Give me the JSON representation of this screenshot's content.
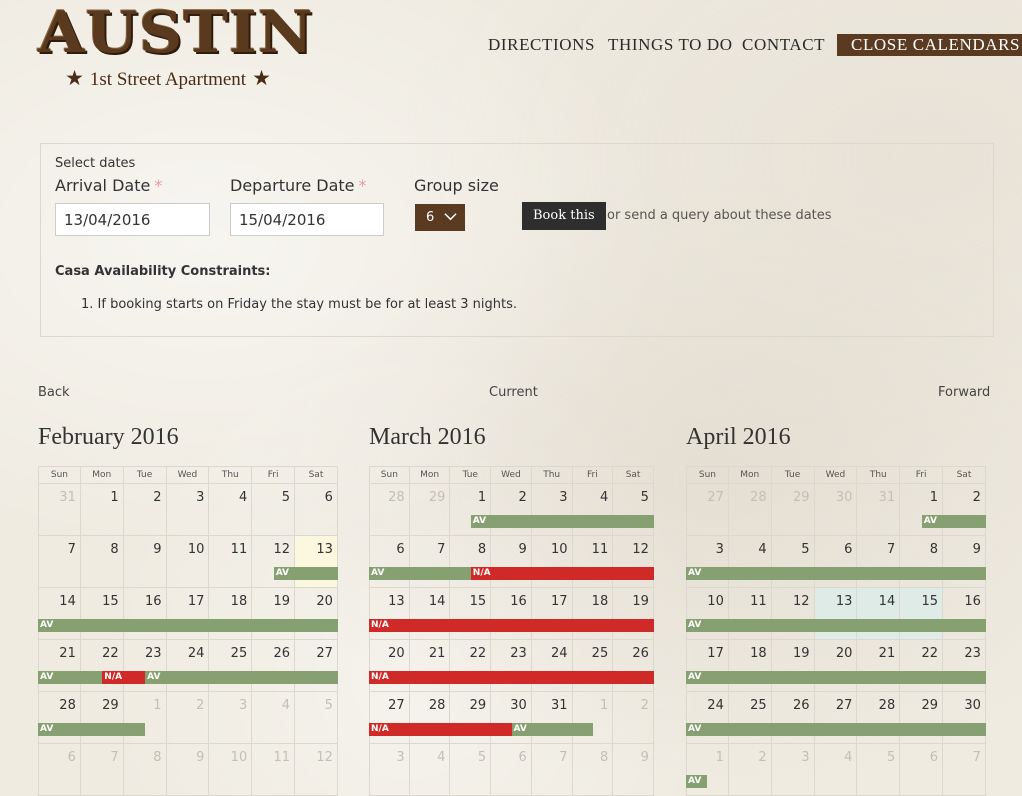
{
  "logo": {
    "title": "AUSTIN",
    "subtitle": "1st Street Apartment",
    "star": "★"
  },
  "nav": {
    "directions": "DIRECTIONS",
    "things_to_do": "THINGS TO DO",
    "contact": "CONTACT",
    "close_calendars": "CLOSE CALENDARS"
  },
  "booking": {
    "select_dates": "Select dates",
    "arrival_label": "Arrival Date",
    "departure_label": "Departure Date",
    "required_mark": "*",
    "group_label": "Group size",
    "arrival_value": "13/04/2016",
    "departure_value": "15/04/2016",
    "group_value": "6",
    "book_button": "Book this",
    "query_text": "or send a query about these dates",
    "constraints_title": "Casa Availability Constraints:",
    "constraint_1": "1. If booking starts on Friday the stay must be for at least 3 nights."
  },
  "calendar_nav": {
    "back": "Back",
    "current": "Current",
    "forward": "Forward"
  },
  "weekdays": [
    "Sun",
    "Mon",
    "Tue",
    "Wed",
    "Thu",
    "Fri",
    "Sat"
  ],
  "status_labels": {
    "available": "AV",
    "not_available": "N/A"
  },
  "calendars": [
    {
      "title": "February 2016",
      "weeks": [
        [
          {
            "d": "31",
            "o": true
          },
          {
            "d": "1"
          },
          {
            "d": "2"
          },
          {
            "d": "3"
          },
          {
            "d": "4"
          },
          {
            "d": "5"
          },
          {
            "d": "6"
          }
        ],
        [
          {
            "d": "7"
          },
          {
            "d": "8"
          },
          {
            "d": "9"
          },
          {
            "d": "10"
          },
          {
            "d": "11"
          },
          {
            "d": "12"
          },
          {
            "d": "13",
            "hl": "sel"
          }
        ],
        [
          {
            "d": "14"
          },
          {
            "d": "15"
          },
          {
            "d": "16"
          },
          {
            "d": "17"
          },
          {
            "d": "18"
          },
          {
            "d": "19"
          },
          {
            "d": "20"
          }
        ],
        [
          {
            "d": "21"
          },
          {
            "d": "22"
          },
          {
            "d": "23"
          },
          {
            "d": "24"
          },
          {
            "d": "25"
          },
          {
            "d": "26"
          },
          {
            "d": "27"
          }
        ],
        [
          {
            "d": "28"
          },
          {
            "d": "29"
          },
          {
            "d": "1",
            "o": true
          },
          {
            "d": "2",
            "o": true
          },
          {
            "d": "3",
            "o": true
          },
          {
            "d": "4",
            "o": true
          },
          {
            "d": "5",
            "o": true
          }
        ],
        [
          {
            "d": "6",
            "o": true
          },
          {
            "d": "7",
            "o": true
          },
          {
            "d": "8",
            "o": true
          },
          {
            "d": "9",
            "o": true
          },
          {
            "d": "10",
            "o": true
          },
          {
            "d": "11",
            "o": true
          },
          {
            "d": "12",
            "o": true
          }
        ]
      ],
      "bars": [
        {
          "week": 1,
          "start": 5.5,
          "end": 7,
          "status": "av"
        },
        {
          "week": 2,
          "start": 0,
          "end": 7,
          "status": "av"
        },
        {
          "week": 3,
          "start": 0,
          "end": 1.5,
          "status": "av"
        },
        {
          "week": 3,
          "start": 1.5,
          "end": 2.5,
          "status": "na"
        },
        {
          "week": 3,
          "start": 2.5,
          "end": 7,
          "status": "av"
        },
        {
          "week": 4,
          "start": 0,
          "end": 2.5,
          "status": "av"
        }
      ]
    },
    {
      "title": "March 2016",
      "weeks": [
        [
          {
            "d": "28",
            "o": true
          },
          {
            "d": "29",
            "o": true
          },
          {
            "d": "1"
          },
          {
            "d": "2"
          },
          {
            "d": "3"
          },
          {
            "d": "4"
          },
          {
            "d": "5"
          }
        ],
        [
          {
            "d": "6"
          },
          {
            "d": "7"
          },
          {
            "d": "8"
          },
          {
            "d": "9"
          },
          {
            "d": "10"
          },
          {
            "d": "11"
          },
          {
            "d": "12"
          }
        ],
        [
          {
            "d": "13"
          },
          {
            "d": "14"
          },
          {
            "d": "15"
          },
          {
            "d": "16"
          },
          {
            "d": "17"
          },
          {
            "d": "18"
          },
          {
            "d": "19"
          }
        ],
        [
          {
            "d": "20"
          },
          {
            "d": "21"
          },
          {
            "d": "22"
          },
          {
            "d": "23"
          },
          {
            "d": "24"
          },
          {
            "d": "25"
          },
          {
            "d": "26"
          }
        ],
        [
          {
            "d": "27"
          },
          {
            "d": "28"
          },
          {
            "d": "29"
          },
          {
            "d": "30"
          },
          {
            "d": "31"
          },
          {
            "d": "1",
            "o": true
          },
          {
            "d": "2",
            "o": true
          }
        ],
        [
          {
            "d": "3",
            "o": true
          },
          {
            "d": "4",
            "o": true
          },
          {
            "d": "5",
            "o": true
          },
          {
            "d": "6",
            "o": true
          },
          {
            "d": "7",
            "o": true
          },
          {
            "d": "8",
            "o": true
          },
          {
            "d": "9",
            "o": true
          }
        ]
      ],
      "bars": [
        {
          "week": 0,
          "start": 2.5,
          "end": 7,
          "status": "av"
        },
        {
          "week": 1,
          "start": 0,
          "end": 2.5,
          "status": "av"
        },
        {
          "week": 1,
          "start": 2.5,
          "end": 7,
          "status": "na"
        },
        {
          "week": 2,
          "start": 0,
          "end": 7,
          "status": "na"
        },
        {
          "week": 3,
          "start": 0,
          "end": 7,
          "status": "na"
        },
        {
          "week": 4,
          "start": 0,
          "end": 3.5,
          "status": "na"
        },
        {
          "week": 4,
          "start": 3.5,
          "end": 5.5,
          "status": "av"
        }
      ]
    },
    {
      "title": "April 2016",
      "weeks": [
        [
          {
            "d": "27",
            "o": true
          },
          {
            "d": "28",
            "o": true
          },
          {
            "d": "29",
            "o": true
          },
          {
            "d": "30",
            "o": true
          },
          {
            "d": "31",
            "o": true
          },
          {
            "d": "1"
          },
          {
            "d": "2"
          }
        ],
        [
          {
            "d": "3"
          },
          {
            "d": "4"
          },
          {
            "d": "5"
          },
          {
            "d": "6"
          },
          {
            "d": "7"
          },
          {
            "d": "8"
          },
          {
            "d": "9"
          }
        ],
        [
          {
            "d": "10"
          },
          {
            "d": "11"
          },
          {
            "d": "12"
          },
          {
            "d": "13",
            "hl": "range"
          },
          {
            "d": "14",
            "hl": "range"
          },
          {
            "d": "15",
            "hl": "range"
          },
          {
            "d": "16"
          }
        ],
        [
          {
            "d": "17"
          },
          {
            "d": "18"
          },
          {
            "d": "19"
          },
          {
            "d": "20"
          },
          {
            "d": "21"
          },
          {
            "d": "22"
          },
          {
            "d": "23"
          }
        ],
        [
          {
            "d": "24"
          },
          {
            "d": "25"
          },
          {
            "d": "26"
          },
          {
            "d": "27"
          },
          {
            "d": "28"
          },
          {
            "d": "29"
          },
          {
            "d": "30"
          }
        ],
        [
          {
            "d": "1",
            "o": true
          },
          {
            "d": "2",
            "o": true
          },
          {
            "d": "3",
            "o": true
          },
          {
            "d": "4",
            "o": true
          },
          {
            "d": "5",
            "o": true
          },
          {
            "d": "6",
            "o": true
          },
          {
            "d": "7",
            "o": true
          }
        ]
      ],
      "bars": [
        {
          "week": 0,
          "start": 5.5,
          "end": 7,
          "status": "av"
        },
        {
          "week": 1,
          "start": 0,
          "end": 7,
          "status": "av"
        },
        {
          "week": 2,
          "start": 0,
          "end": 7,
          "status": "av"
        },
        {
          "week": 3,
          "start": 0,
          "end": 7,
          "status": "av"
        },
        {
          "week": 4,
          "start": 0,
          "end": 7,
          "status": "av"
        },
        {
          "week": 5,
          "start": 0,
          "end": 0.5,
          "status": "av"
        }
      ]
    }
  ]
}
